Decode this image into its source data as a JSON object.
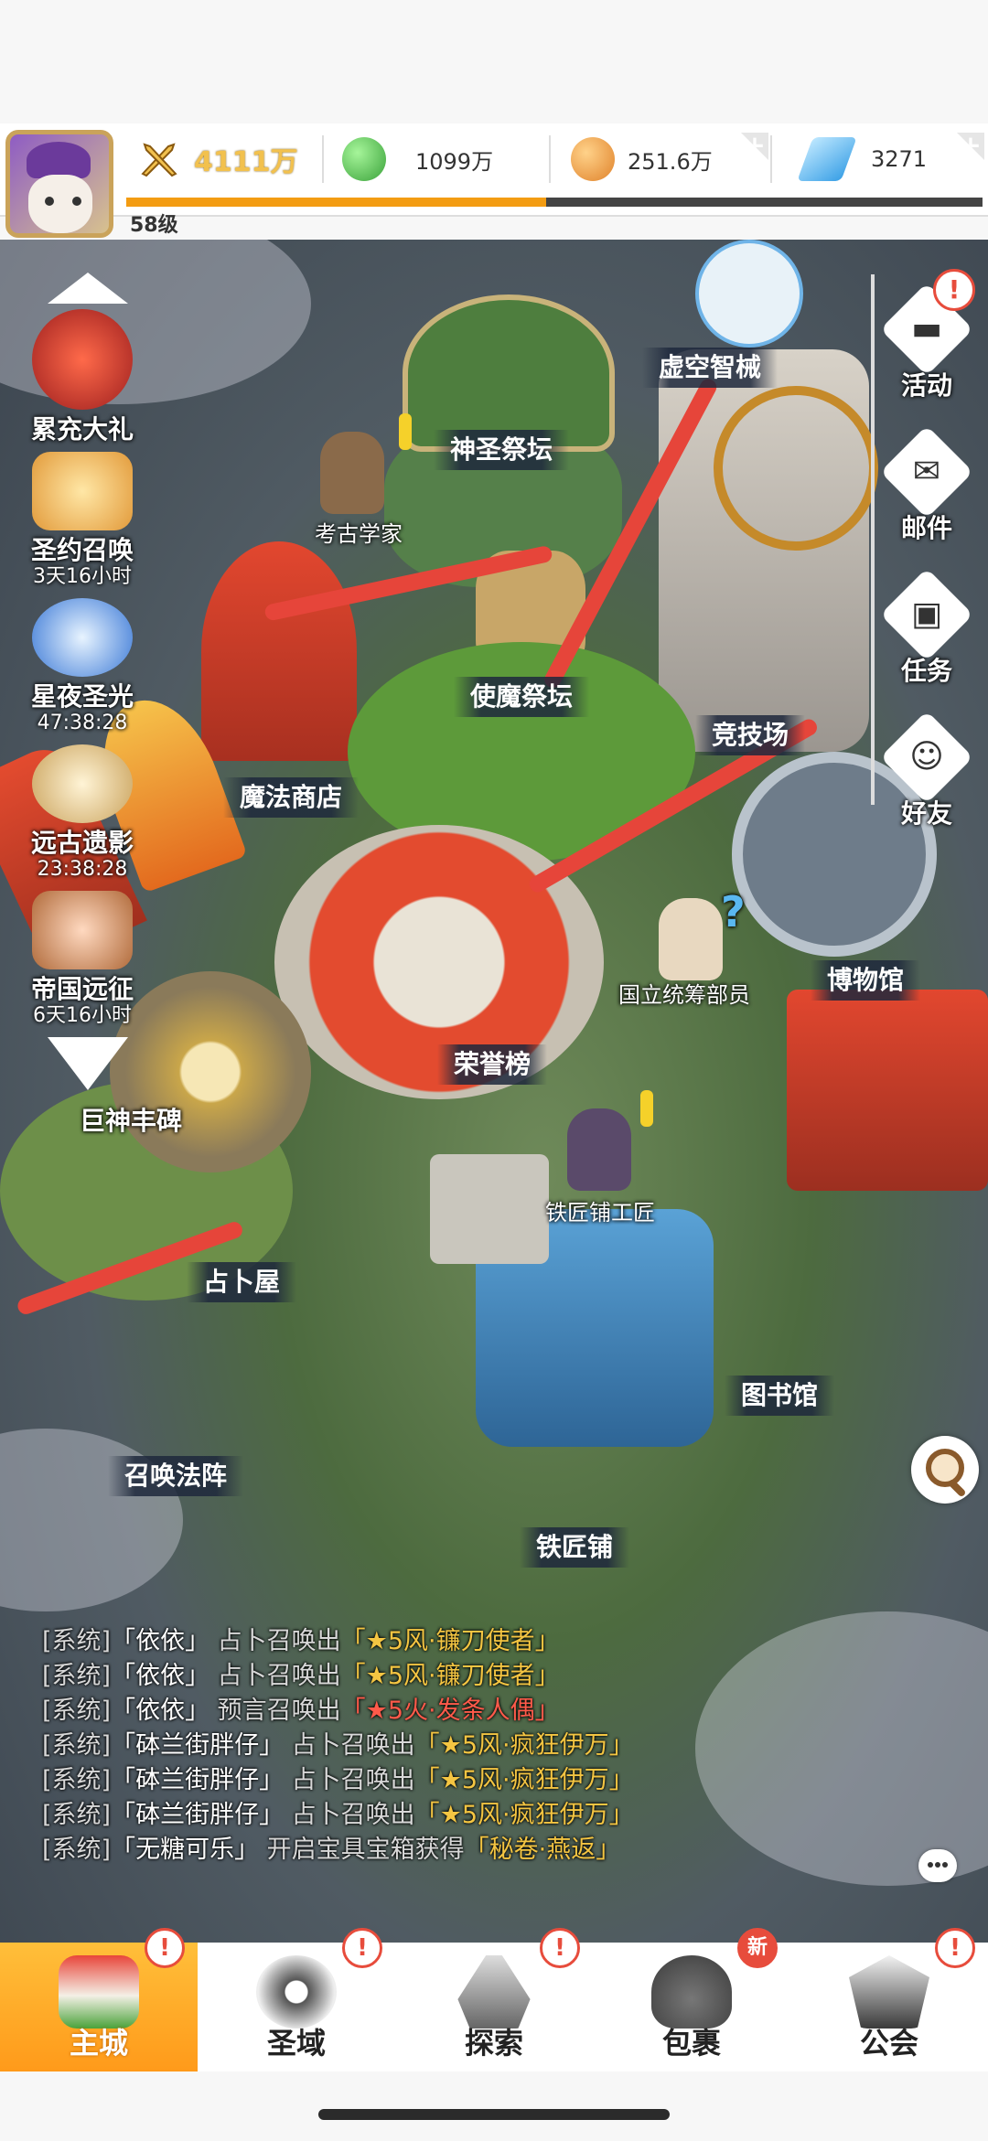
{
  "player": {
    "level": "58级",
    "xp_fraction": 0.49
  },
  "resources": [
    {
      "name": "power",
      "value": "4111万",
      "icon": "crossed-swords-icon",
      "color": "#f2c14e"
    },
    {
      "name": "green-gem",
      "value": "1099万",
      "icon": "green-orb-icon",
      "color": "#4cc04a"
    },
    {
      "name": "gold",
      "value": "251.6万",
      "icon": "gold-coin-icon",
      "color": "#f29d38"
    },
    {
      "name": "diamond",
      "value": "3271",
      "icon": "blue-diamond-icon",
      "color": "#4ab2ee"
    }
  ],
  "left_events": {
    "recharge": {
      "label": "累充大礼"
    },
    "covenant": {
      "label": "圣约召唤",
      "time": "3天16小时"
    },
    "starlight": {
      "label": "星夜圣光",
      "time": "47:38:28"
    },
    "ancient": {
      "label": "远古遗影",
      "time": "23:38:28"
    },
    "empire": {
      "label": "帝国远征",
      "time": "6天16小时"
    },
    "titan": {
      "label": "巨神丰碑"
    }
  },
  "right_buttons": {
    "activity": {
      "label": "活动",
      "icon": "chat-bubble-icon"
    },
    "mail": {
      "label": "邮件",
      "icon": "envelope-icon"
    },
    "task": {
      "label": "任务",
      "icon": "task-icon"
    },
    "friends": {
      "label": "好友",
      "icon": "wechat-icon"
    }
  },
  "map_locations": {
    "void_mech": "虚空智械",
    "holy_altar": "神圣祭坛",
    "archaeologist": "考古学家",
    "envoy_altar": "使魔祭坛",
    "arena": "竞技场",
    "magic_shop": "魔法商店",
    "museum": "博物馆",
    "national_officer": "国立统筹部员",
    "honor_board": "荣誉榜",
    "blacksmith_worker": "铁匠铺工匠",
    "divination_house": "占卜屋",
    "library": "图书馆",
    "summon_circle": "召唤法阵",
    "blacksmith": "铁匠铺"
  },
  "chat": [
    {
      "tag": "[系统]",
      "user": "「依依」",
      "action": "占卜召唤出",
      "item": "「★5风·镰刀使者」",
      "color": "gold"
    },
    {
      "tag": "[系统]",
      "user": "「依依」",
      "action": "占卜召唤出",
      "item": "「★5风·镰刀使者」",
      "color": "gold"
    },
    {
      "tag": "[系统]",
      "user": "「依依」",
      "action": "预言召唤出",
      "item": "「★5火·发条人偶」",
      "color": "red"
    },
    {
      "tag": "[系统]",
      "user": "「砵兰街胖仔」",
      "action": "占卜召唤出",
      "item": "「★5风·疯狂伊万」",
      "color": "gold"
    },
    {
      "tag": "[系统]",
      "user": "「砵兰街胖仔」",
      "action": "占卜召唤出",
      "item": "「★5风·疯狂伊万」",
      "color": "gold"
    },
    {
      "tag": "[系统]",
      "user": "「砵兰街胖仔」",
      "action": "占卜召唤出",
      "item": "「★5风·疯狂伊万」",
      "color": "gold"
    },
    {
      "tag": "[系统]",
      "user": "「无糖可乐」",
      "action": "开启宝具宝箱获得",
      "item": "「秘卷·燕返」",
      "color": "gold"
    }
  ],
  "nav": {
    "main_city": {
      "label": "主城",
      "badge": "!"
    },
    "holy_domain": {
      "label": "圣域",
      "badge": "!"
    },
    "explore": {
      "label": "探索",
      "badge": "!"
    },
    "bag": {
      "label": "包裹",
      "badge": "新"
    },
    "guild": {
      "label": "公会",
      "badge": "!"
    }
  }
}
